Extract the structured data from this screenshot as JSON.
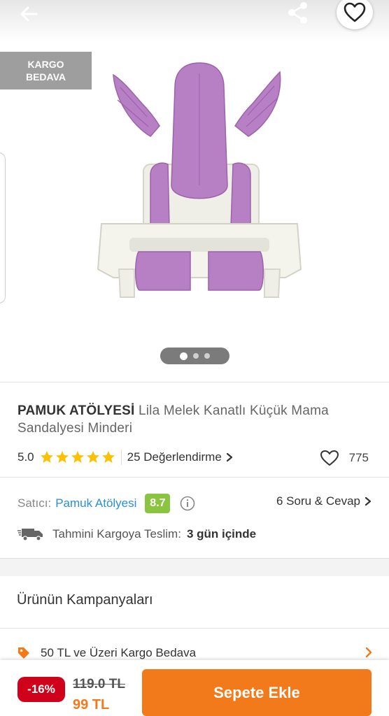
{
  "badges": {
    "kargo_line1": "KARGO",
    "kargo_line2": "BEDAVA"
  },
  "gallery": {
    "image_count": 3,
    "active_index": 0
  },
  "product": {
    "brand": "PAMUK ATÖLYESİ",
    "name": "Lila Melek Kanatlı Küçük Mama Sandalyesi Minderi",
    "rating": "5.0",
    "stars": 5,
    "reviews_label": "25 Değerlendirme",
    "favorites_count": "775"
  },
  "seller": {
    "label": "Satıcı:",
    "name": "Pamuk Atölyesi",
    "score": "8.7",
    "qa_label": "6 Soru & Cevap"
  },
  "shipping": {
    "label": "Tahmini Kargoya Teslim:",
    "days": "3 gün içinde"
  },
  "campaigns": {
    "title": "Ürünün Kampanyaları",
    "items": [
      {
        "label": "50 TL ve Üzeri Kargo Bedava"
      }
    ]
  },
  "purchase": {
    "discount": "-16%",
    "old_price": "119.0 TL",
    "new_price": "99 TL",
    "button_label": "Sepete Ekle"
  },
  "colors": {
    "accent": "#f27a1a",
    "discount_red": "#d0021b",
    "seller_blue": "#2a8fd3",
    "score_green": "#8bc53f",
    "star_gold": "#ffc000",
    "cushion_lilac": "#b77fc4"
  },
  "icons": {
    "back": "arrow-left-icon",
    "share": "share-icon",
    "favorite": "heart-icon",
    "star": "star-icon",
    "chevron": "chevron-right-icon",
    "info": "info-icon",
    "truck": "truck-icon",
    "tag": "tag-icon"
  }
}
